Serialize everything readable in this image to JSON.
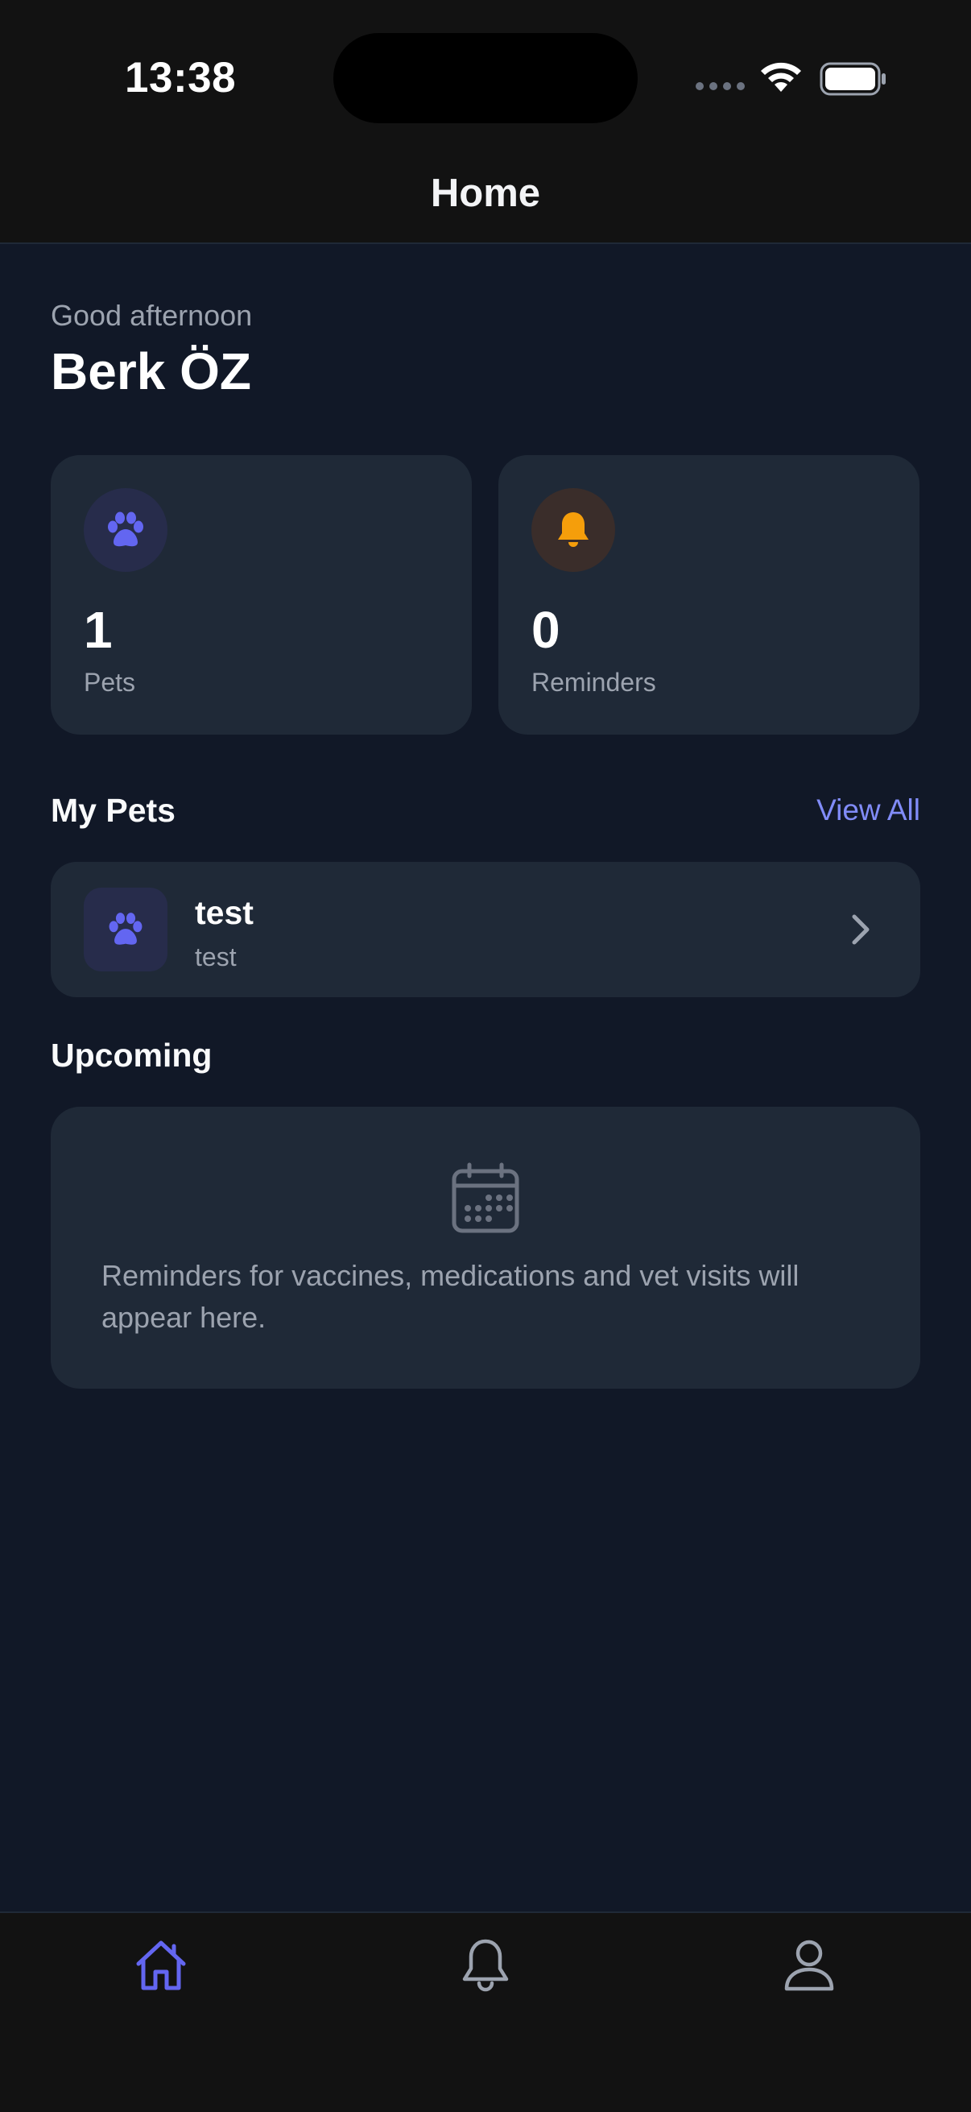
{
  "status_bar": {
    "time": "13:38"
  },
  "header": {
    "title": "Home"
  },
  "greeting": {
    "subtitle": "Good afternoon",
    "name": "Berk ÖZ"
  },
  "stats": [
    {
      "value": "1",
      "label": "Pets",
      "icon": "paw-icon"
    },
    {
      "value": "0",
      "label": "Reminders",
      "icon": "bell-icon"
    }
  ],
  "my_pets": {
    "title": "My Pets",
    "view_all_label": "View All",
    "items": [
      {
        "name": "test",
        "species": "test",
        "icon": "paw-icon"
      }
    ]
  },
  "upcoming": {
    "title": "Upcoming",
    "empty_message": "Reminders for vaccines, medications and vet visits will appear here.",
    "icon": "calendar-icon"
  },
  "tabbar": [
    {
      "name": "home",
      "icon": "home-icon",
      "active": true
    },
    {
      "name": "reminders",
      "icon": "bell-icon",
      "active": false
    },
    {
      "name": "profile",
      "icon": "person-icon",
      "active": false
    }
  ],
  "colors": {
    "background": "#111827",
    "card": "#1f2937",
    "accent": "#818cf8",
    "paw": "#6366f1",
    "bell": "#f59e0b",
    "muted": "#9ca3af"
  }
}
